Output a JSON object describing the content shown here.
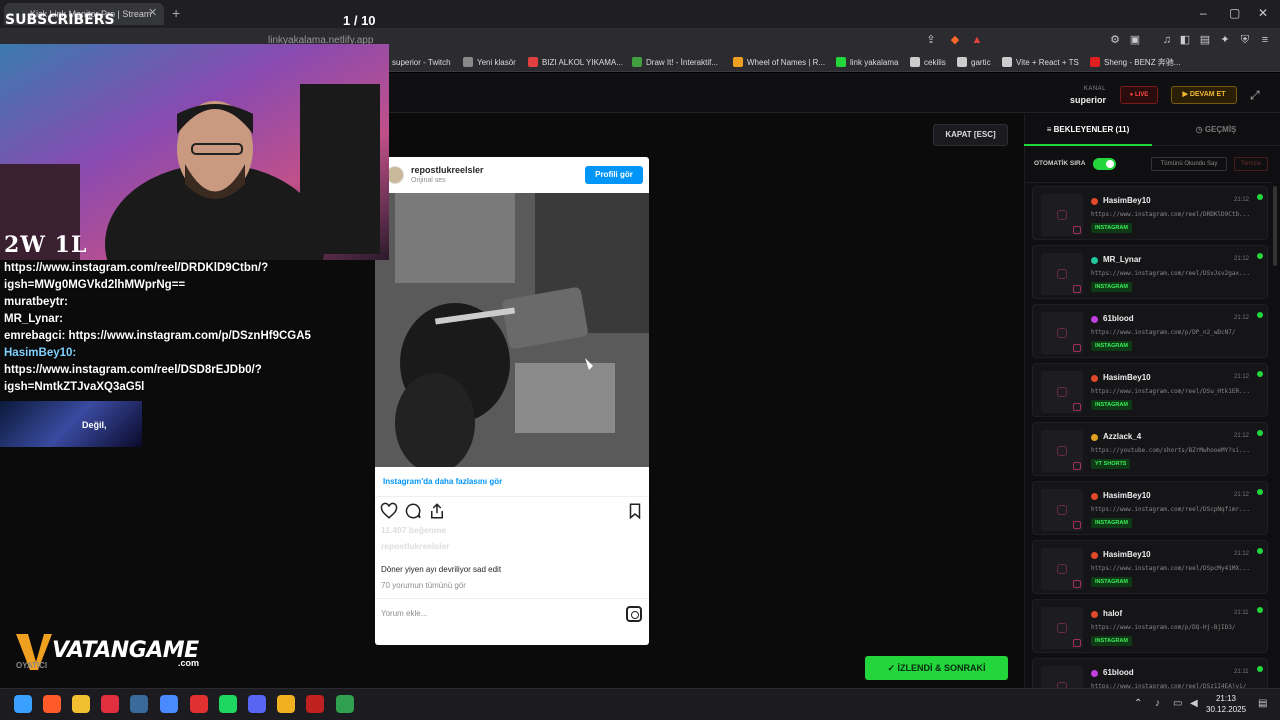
{
  "browser": {
    "tab_title": "Kick Link Monitor Pro | Stream",
    "url": "linkyakalama.netlify.app",
    "bookmarks": [
      {
        "label": "superior - Twitch",
        "color": "#9146ff"
      },
      {
        "label": "Yeni klasör",
        "color": "#888888"
      },
      {
        "label": "BIZI ALKOL YIKAMA...",
        "color": "#e04040"
      },
      {
        "label": "Draw It! - İnteraktif...",
        "color": "#40a040"
      },
      {
        "label": "Wheel of Names | R...",
        "color": "#f0a020"
      },
      {
        "label": "link yakalama",
        "color": "#22d63c"
      },
      {
        "label": "cekilis",
        "color": "#cccccc"
      },
      {
        "label": "gartic",
        "color": "#cccccc"
      },
      {
        "label": "Vite + React + TS",
        "color": "#cccccc"
      },
      {
        "label": "Sheng - BENZ 奔驰...",
        "color": "#e02020"
      }
    ]
  },
  "header": {
    "kanal_label": "KANAL",
    "kanal_name": "superior",
    "live_label": "LIVE",
    "devam_label": "DEVAM ET"
  },
  "main": {
    "kapat_label": "KAPAT [ESC]",
    "izlendi_label": "İZLENDİ & SONRAKİ"
  },
  "instagram": {
    "username": "repostlukreelsler",
    "subtitle": "Orijinal ses",
    "profile_button": "Profili gör",
    "more_link": "Instagram'da daha fazlasını gör",
    "likes": "11.407 beğenme",
    "owner": "repostlukreelsler",
    "caption": "Döner yiyen ayı devriliyor sad edit",
    "comments_link": "70 yorumun tümünü gör",
    "comment_placeholder": "Yorum ekle..."
  },
  "panel": {
    "tab_waiting": "BEKLEYENLER (11)",
    "tab_history": "GEÇMİŞ",
    "auto_label": "OTOMATİK SIRA",
    "auto_enabled": true,
    "read_all_label": "Tümünü Okundu Say",
    "clear_label": "Temizle",
    "queue": [
      {
        "user": "HasimBey10",
        "time": "21:12",
        "url": "https://www.instagram.com/reel/DRDKlD9Ctb...",
        "badge": "INSTAGRAM",
        "dot": "#e04a2a"
      },
      {
        "user": "MR_Lynar",
        "time": "21:12",
        "url": "https://www.instagram.com/reel/DSvJsv2gax...",
        "badge": "INSTAGRAM",
        "dot": "#22c8a0"
      },
      {
        "user": "61blood",
        "time": "21:12",
        "url": "https://www.instagram.com/p/DP_n2_wDcN7/",
        "badge": "INSTAGRAM",
        "dot": "#c040e0"
      },
      {
        "user": "HasimBey10",
        "time": "21:12",
        "url": "https://www.instagram.com/reel/DSu_Htk1ER...",
        "badge": "INSTAGRAM",
        "dot": "#e04a2a"
      },
      {
        "user": "Azzlack_4",
        "time": "21:12",
        "url": "https://youtube.com/shorts/BZrMwhooeMY?si...",
        "badge": "YT SHORTS",
        "dot": "#e0a020"
      },
      {
        "user": "HasimBey10",
        "time": "21:12",
        "url": "https://www.instagram.com/reel/DScpNqfimr...",
        "badge": "INSTAGRAM",
        "dot": "#e04a2a"
      },
      {
        "user": "HasimBey10",
        "time": "21:12",
        "url": "https://www.instagram.com/reel/DSpcMy41MX...",
        "badge": "INSTAGRAM",
        "dot": "#e04a2a"
      },
      {
        "user": "halof",
        "time": "21:11",
        "url": "https://www.instagram.com/p/DQ-Hj-BjID3/",
        "badge": "INSTAGRAM",
        "dot": "#e04a2a"
      },
      {
        "user": "61blood",
        "time": "21:11",
        "url": "https://www.instagram.com/reel/DSz1I4EAjvi/",
        "badge": "INSTAGRAM",
        "dot": "#c040e0"
      }
    ]
  },
  "overlay": {
    "subscribers_label": "SUBSCRIBERS",
    "page_counter": "1 / 10",
    "wl_score": "2W 1L",
    "chat": [
      {
        "parts": [
          {
            "t": "https://www.instagram.com/reel/DRDKlD9Ctbn/?igsh=MWg0MGVkd2lhMWprNg==",
            "c": "txt"
          }
        ]
      },
      {
        "parts": [
          {
            "t": "muratbeytr:",
            "c": "nm"
          }
        ]
      },
      {
        "parts": [
          {
            "t": "MR_Lynar:",
            "c": "nm"
          }
        ]
      },
      {
        "parts": [
          {
            "t": "emrebagci:",
            "c": "nm"
          },
          {
            "t": " https://www.instagram.com/p/DSznHf9CGA5",
            "c": "txt"
          }
        ]
      },
      {
        "parts": [
          {
            "t": "HasimBey10:",
            "c": "nm2"
          }
        ]
      },
      {
        "parts": [
          {
            "t": "https://www.instagram.com/reel/DSD8rEJDb0/?igsh=NmtkZTJvaXQ3aG5l",
            "c": "txt"
          }
        ]
      }
    ],
    "chat_video_text": "Değil,",
    "vatan_text": "VATANGAME",
    "vatan_com": ".com",
    "oyatici": "OYATICI"
  },
  "taskbar": {
    "time": "21:13",
    "date": "30.12.2025"
  }
}
